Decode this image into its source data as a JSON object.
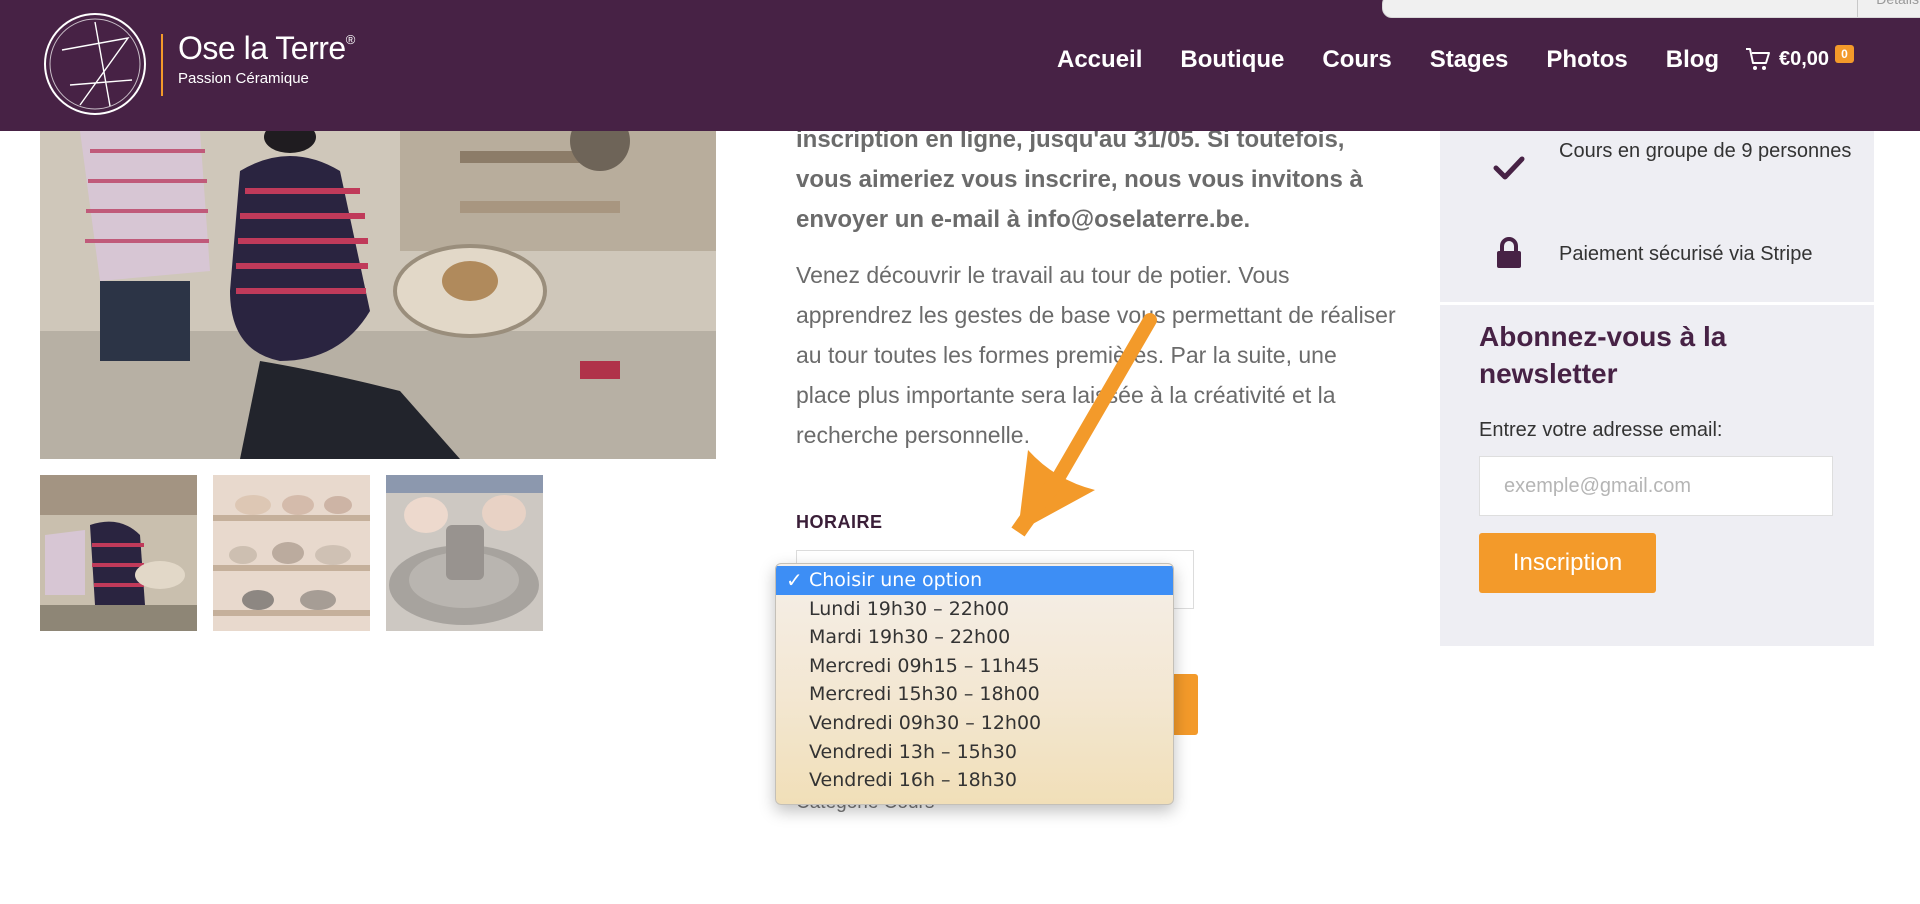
{
  "header": {
    "brand_name": "Ose la Terre",
    "brand_reg": "®",
    "tagline": "Passion Céramique",
    "nav": [
      "Accueil",
      "Boutique",
      "Cours",
      "Stages",
      "Photos",
      "Blog"
    ],
    "cart_total": "€0,00",
    "cart_count": "0",
    "top_search_button": "Details"
  },
  "product": {
    "notice": "inscription en ligne, jusqu'au 31/05. Si toutefois, vous aimeriez vous inscrire, nous vous invitons à envoyer un e-mail à info@oselaterre.be.",
    "description": "Venez découvrir le travail au tour de potier. Vous apprendrez les gestes de base vous permettant de réaliser au tour toutes les formes premières. Par la suite, une place plus importante sera laissée à la créativité et la recherche personnelle.",
    "horaire_label": "HORAIRE",
    "category": "Catégorie Cours"
  },
  "dropdown": {
    "selected_mark": "✓",
    "options": [
      "Choisir une option",
      "Lundi 19h30 – 22h00",
      "Mardi 19h30 – 22h00",
      "Mercredi 09h15 – 11h45",
      "Mercredi 15h30 – 18h00",
      "Vendredi 09h30 – 12h00",
      "Vendredi 13h – 15h30",
      "Vendredi 16h – 18h30"
    ]
  },
  "sidebar": {
    "features": [
      {
        "icon": "check-icon",
        "text": "Cours en groupe de 9 personnes"
      },
      {
        "icon": "lock-icon",
        "text": "Paiement sécurisé via Stripe"
      }
    ],
    "newsletter_title": "Abonnez-vous à la newsletter",
    "email_label": "Entrez votre adresse email:",
    "email_placeholder": "exemple@gmail.com",
    "subscribe_label": "Inscription"
  },
  "colors": {
    "header_bg": "#472245",
    "accent": "#f39a2a",
    "sidebar_bg": "#eeeef3",
    "selected_option": "#3d8ef5"
  }
}
